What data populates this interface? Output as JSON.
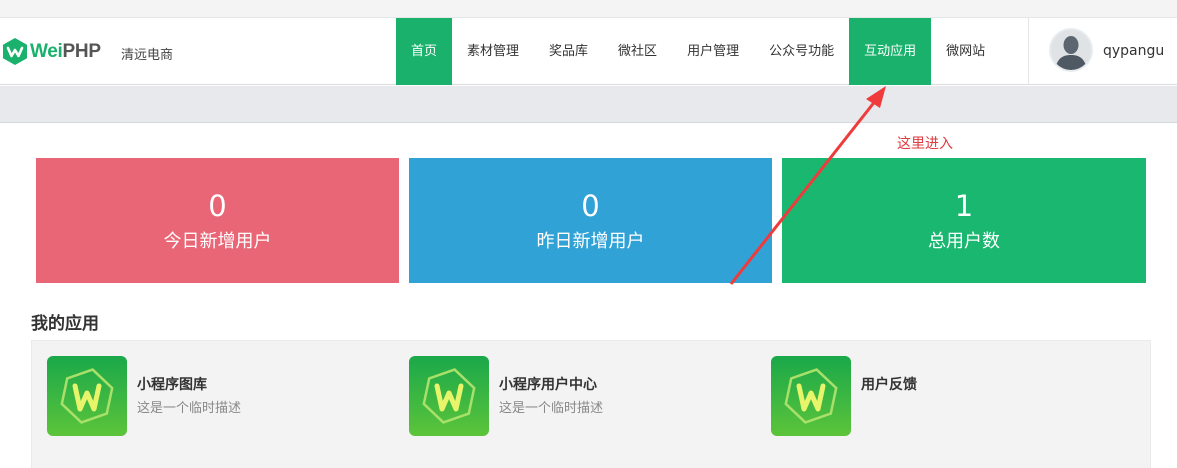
{
  "brand": {
    "logo_part1": "Wei",
    "logo_part2": "PHP",
    "shop_name": "清远电商",
    "logo_color": "#19b16b"
  },
  "nav": {
    "items": [
      {
        "label": "首页",
        "state": "active"
      },
      {
        "label": "素材管理",
        "state": "normal"
      },
      {
        "label": "奖品库",
        "state": "normal"
      },
      {
        "label": "微社区",
        "state": "normal"
      },
      {
        "label": "用户管理",
        "state": "normal"
      },
      {
        "label": "公众号功能",
        "state": "normal"
      },
      {
        "label": "互动应用",
        "state": "highlighted"
      },
      {
        "label": "微网站",
        "state": "normal"
      }
    ],
    "accent_color": "#19b16b"
  },
  "user": {
    "username": "qypangu",
    "avatar_icon": "user-silhouette-icon"
  },
  "annotation": {
    "text": "这里进入",
    "color": "#e0393e"
  },
  "stats": {
    "today": {
      "value": "0",
      "label": "今日新增用户",
      "color": "#e96676"
    },
    "yesterday": {
      "value": "0",
      "label": "昨日新增用户",
      "color": "#31a2d6"
    },
    "total": {
      "value": "1",
      "label": "总用户数",
      "color": "#1ab771"
    }
  },
  "apps": {
    "title": "我的应用",
    "items": [
      {
        "name": "小程序图库",
        "desc": "这是一个临时描述",
        "icon": "weiphp-app-icon"
      },
      {
        "name": "小程序用户中心",
        "desc": "这是一个临时描述",
        "icon": "weiphp-app-icon"
      },
      {
        "name": "用户反馈",
        "desc": "",
        "icon": "weiphp-app-icon"
      }
    ]
  }
}
